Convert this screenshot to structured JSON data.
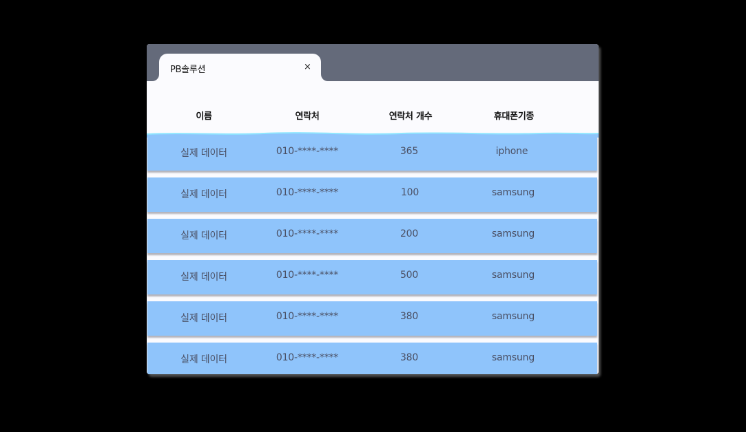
{
  "tab": {
    "title": "PB솔루션",
    "close_label": "×"
  },
  "table": {
    "headers": [
      "이름",
      "연락처",
      "연락처 개수",
      "휴대폰기종"
    ],
    "rows": [
      [
        "실제 데이터",
        "010-****-****",
        "365",
        "iphone"
      ],
      [
        "실제 데이터",
        "010-****-****",
        "100",
        "samsung"
      ],
      [
        "실제 데이터",
        "010-****-****",
        "200",
        "samsung"
      ],
      [
        "실제 데이터",
        "010-****-****",
        "500",
        "samsung"
      ],
      [
        "실제 데이터",
        "010-****-****",
        "380",
        "samsung"
      ],
      [
        "실제 데이터",
        "010-****-****",
        "380",
        "samsung"
      ]
    ]
  },
  "colors": {
    "background": "#000000",
    "titlebar": "#646a7a",
    "panel": "#fbfbfe",
    "row": "#8fc4fb",
    "wave": "#8fe6ff",
    "row_text": "#4a4f63"
  }
}
